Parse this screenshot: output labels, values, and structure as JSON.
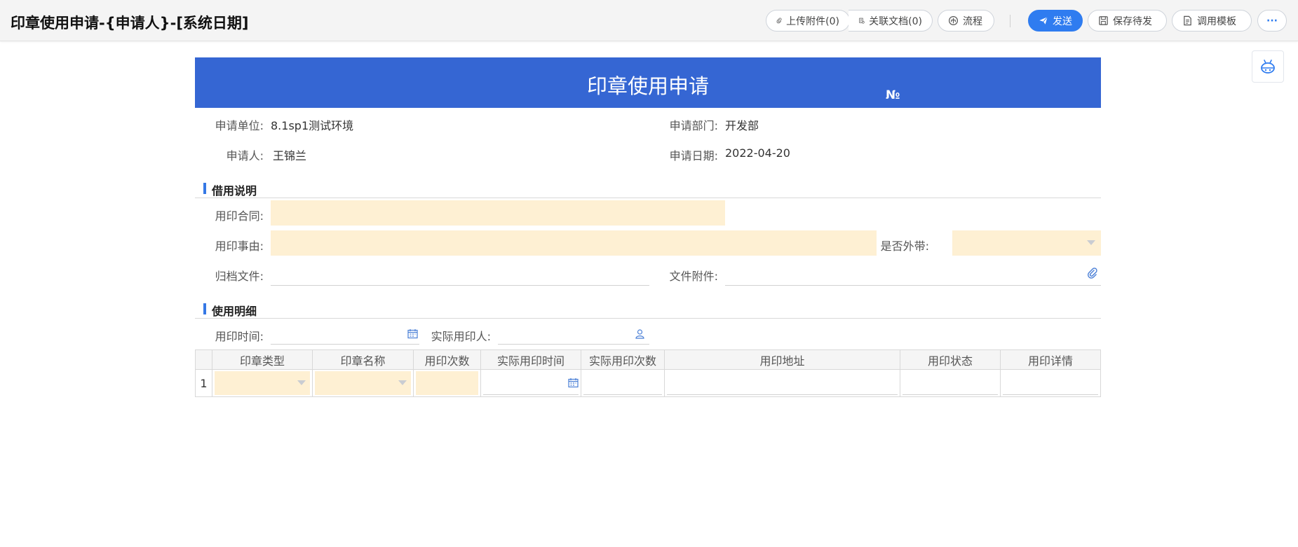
{
  "header": {
    "title": "印章使用申请-{申请人}-[系统日期]",
    "buttons": {
      "upload": "上传附件(0)",
      "related": "关联文档(0)",
      "flow": "流程",
      "send": "发送",
      "save_draft": "保存待发",
      "template": "调用模板",
      "more": "···"
    }
  },
  "form": {
    "title": "印章使用申请",
    "no_label": "№",
    "apply_unit_label": "申请单位:",
    "apply_unit": "8.1sp1测试环境",
    "apply_dept_label": "申请部门:",
    "apply_dept": "开发部",
    "applicant_label": "申请人:",
    "applicant": "王锦兰",
    "apply_date_label": "申请日期:",
    "apply_date": "2022-04-20",
    "section_borrow": "借用说明",
    "contract_label": "用印合同:",
    "reason_label": "用印事由:",
    "take_out_label": "是否外带:",
    "archive_label": "归档文件:",
    "attachment_label": "文件附件:",
    "section_detail": "使用明细",
    "use_time_label": "用印时间:",
    "actual_user_label": "实际用印人:"
  },
  "table": {
    "columns": [
      "印章类型",
      "印章名称",
      "用印次数",
      "实际用印时间",
      "实际用印次数",
      "用印地址",
      "用印状态",
      "用印详情"
    ],
    "rows": [
      {
        "index": "1"
      }
    ]
  },
  "colors": {
    "banner": "#3566d3",
    "required_field": "#fef0d3",
    "primary_button": "#2f7cf0"
  }
}
